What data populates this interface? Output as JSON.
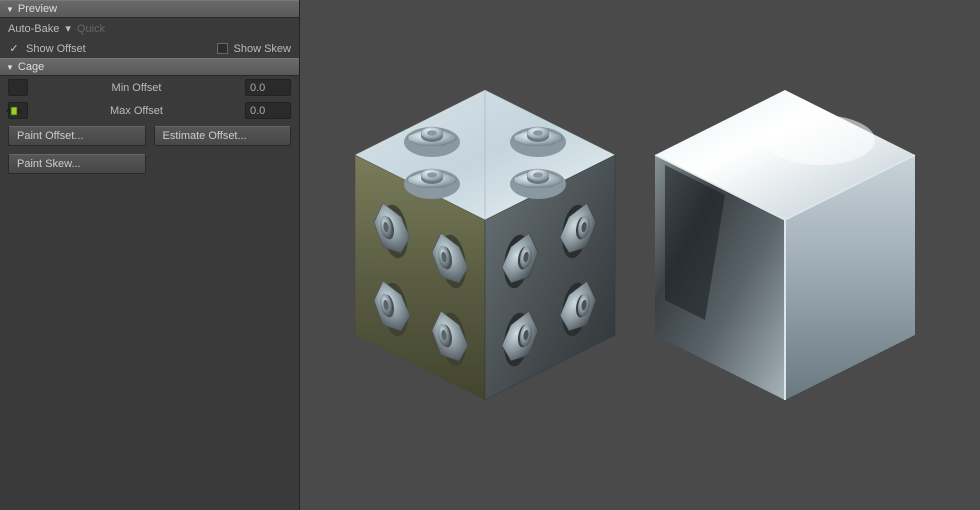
{
  "preview": {
    "title": "Preview",
    "autobake_label": "Auto-Bake",
    "quick_label": "Quick",
    "show_offset_label": "Show Offset",
    "show_offset_checked": true,
    "show_skew_label": "Show Skew",
    "show_skew_checked": false
  },
  "cage": {
    "title": "Cage",
    "min_offset_label": "Min Offset",
    "min_offset_value": "0.0",
    "max_offset_label": "Max Offset",
    "max_offset_value": "0.0",
    "paint_offset_label": "Paint Offset...",
    "estimate_offset_label": "Estimate Offset...",
    "paint_skew_label": "Paint Skew..."
  },
  "icons": {
    "disclosure": "▼",
    "dropdown": "▾",
    "check": "✓"
  }
}
